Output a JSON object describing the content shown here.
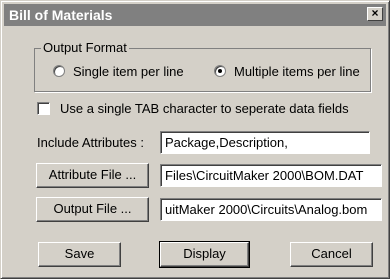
{
  "dialog": {
    "title": "Bill of Materials",
    "close_glyph": "×"
  },
  "output_format": {
    "group_label": "Output Format",
    "single_label": "Single item per line",
    "multiple_label": "Multiple items per line",
    "selected": "multiple"
  },
  "tab_option": {
    "label": "Use a single TAB character to seperate data fields",
    "checked": false
  },
  "attributes": {
    "label": "Include Attributes :",
    "value": "Package,Description,"
  },
  "attribute_file": {
    "button_label": "Attribute File ...",
    "value": "Files\\CircuitMaker 2000\\BOM.DAT"
  },
  "output_file": {
    "button_label": "Output File ...",
    "value": "uitMaker 2000\\Circuits\\Analog.bom"
  },
  "actions": {
    "save_label": "Save",
    "display_label": "Display",
    "cancel_label": "Cancel"
  }
}
